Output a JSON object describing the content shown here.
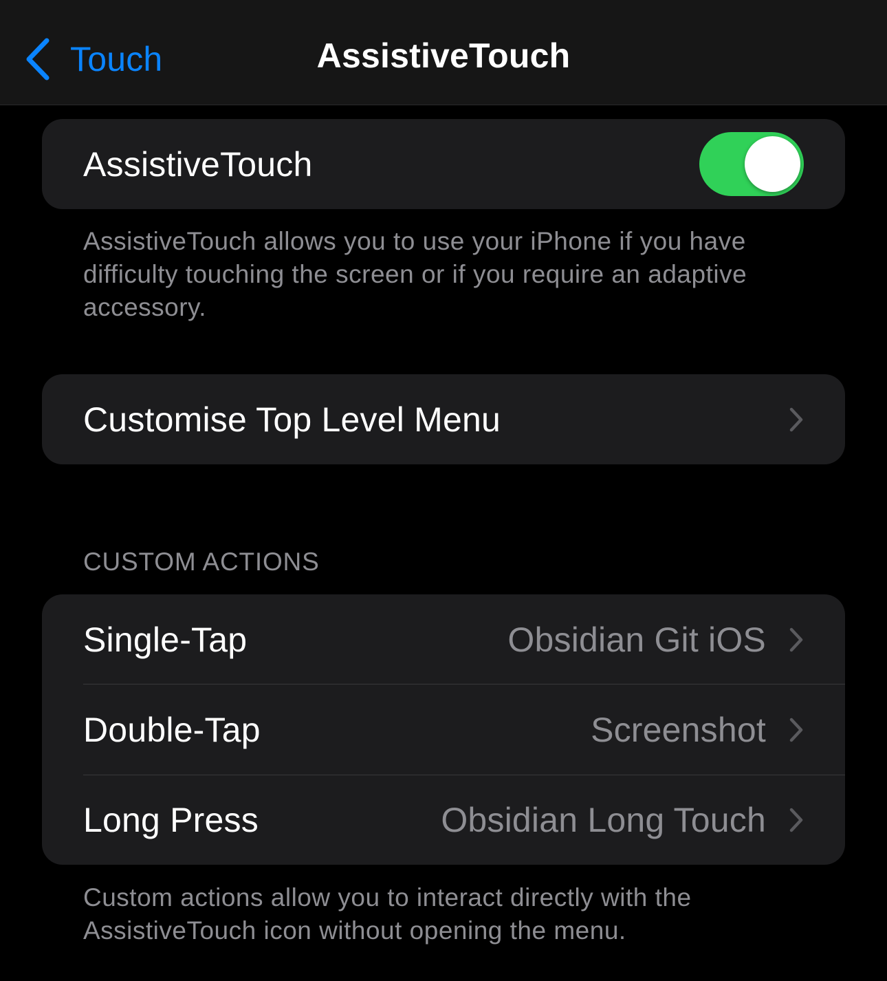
{
  "navbar": {
    "back_label": "Touch",
    "title": "AssistiveTouch"
  },
  "assistive_touch": {
    "label": "AssistiveTouch",
    "enabled": true,
    "footnote": "AssistiveTouch allows you to use your iPhone if you have difficulty touching the screen or if you require an adaptive accessory."
  },
  "menu": {
    "customise_label": "Customise Top Level Menu"
  },
  "custom_actions": {
    "header": "CUSTOM ACTIONS",
    "rows": [
      {
        "label": "Single-Tap",
        "value": "Obsidian Git iOS"
      },
      {
        "label": "Double-Tap",
        "value": "Screenshot"
      },
      {
        "label": "Long Press",
        "value": "Obsidian Long Touch"
      }
    ],
    "footnote": "Custom actions allow you to interact directly with the AssistiveTouch icon without opening the menu."
  },
  "colors": {
    "accent": "#0a84ff",
    "toggle_on": "#30d158",
    "cell_background": "#1c1c1e",
    "secondary_text": "#8e8e93"
  },
  "icons": {
    "back": "chevron-left-icon",
    "disclosure": "chevron-right-icon"
  }
}
